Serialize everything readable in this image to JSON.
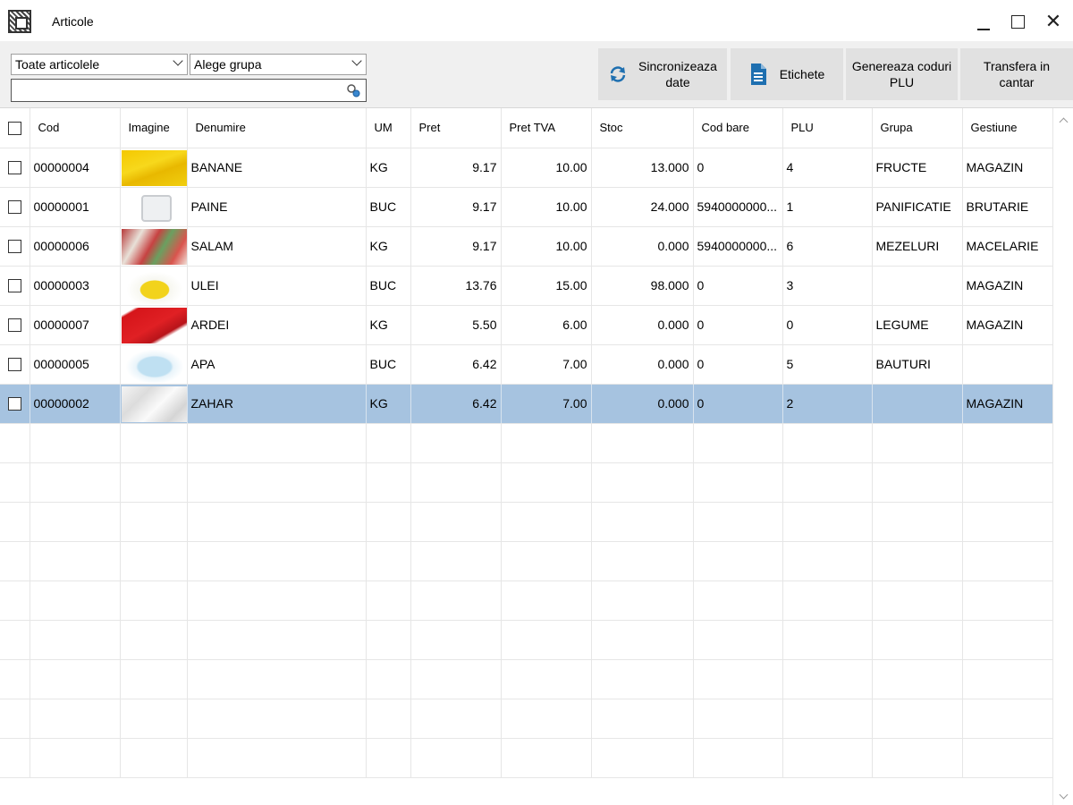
{
  "window": {
    "title": "Articole",
    "close_glyph": "✕"
  },
  "filters": {
    "articles_select": "Toate articolele",
    "group_select": "Alege grupa",
    "search_value": ""
  },
  "toolbar": {
    "sync_line1": "Sincronizeaza",
    "sync_line2": "date",
    "labels": "Etichete",
    "plu_line1": "Genereaza coduri",
    "plu_line2": "PLU",
    "transfer_line1": "Transfera in",
    "transfer_line2": "cantar",
    "accent_color": "#1e6fb0"
  },
  "table": {
    "headers": {
      "cod": "Cod",
      "imagine": "Imagine",
      "denumire": "Denumire",
      "um": "UM",
      "pret": "Pret",
      "pret_tva": "Pret TVA",
      "stoc": "Stoc",
      "cod_bare": "Cod bare",
      "plu": "PLU",
      "grupa": "Grupa",
      "gestiune": "Gestiune"
    },
    "selected_row_color": "#a6c3e0",
    "rows": [
      {
        "cod": "00000004",
        "image": "banana-image",
        "denumire": "BANANE",
        "um": "KG",
        "pret": "9.17",
        "pret_tva": "10.00",
        "stoc": "13.000",
        "cod_bare": "0",
        "plu": "4",
        "grupa": "FRUCTE",
        "gestiune": "MAGAZIN"
      },
      {
        "cod": "00000001",
        "image": "placeholder-image",
        "denumire": "PAINE",
        "um": "BUC",
        "pret": "9.17",
        "pret_tva": "10.00",
        "stoc": "24.000",
        "cod_bare": "5940000000...",
        "plu": "1",
        "grupa": "PANIFICATIE",
        "gestiune": "BRUTARIE"
      },
      {
        "cod": "00000006",
        "image": "salami-image",
        "denumire": "SALAM",
        "um": "KG",
        "pret": "9.17",
        "pret_tva": "10.00",
        "stoc": "0.000",
        "cod_bare": "5940000000...",
        "plu": "6",
        "grupa": "MEZELURI",
        "gestiune": "MACELARIE"
      },
      {
        "cod": "00000003",
        "image": "oil-bottle-image",
        "denumire": "ULEI",
        "um": "BUC",
        "pret": "13.76",
        "pret_tva": "15.00",
        "stoc": "98.000",
        "cod_bare": "0",
        "plu": "3",
        "grupa": "",
        "gestiune": "MAGAZIN"
      },
      {
        "cod": "00000007",
        "image": "pepper-image",
        "denumire": "ARDEI",
        "um": "KG",
        "pret": "5.50",
        "pret_tva": "6.00",
        "stoc": "0.000",
        "cod_bare": "0",
        "plu": "0",
        "grupa": "LEGUME",
        "gestiune": "MAGAZIN"
      },
      {
        "cod": "00000005",
        "image": "water-bottle-image",
        "denumire": "APA",
        "um": "BUC",
        "pret": "6.42",
        "pret_tva": "7.00",
        "stoc": "0.000",
        "cod_bare": "0",
        "plu": "5",
        "grupa": "BAUTURI",
        "gestiune": ""
      },
      {
        "cod": "00000002",
        "image": "sugar-image",
        "denumire": "ZAHAR",
        "um": "KG",
        "pret": "6.42",
        "pret_tva": "7.00",
        "stoc": "0.000",
        "cod_bare": "0",
        "plu": "2",
        "grupa": "",
        "gestiune": "MAGAZIN"
      }
    ]
  }
}
